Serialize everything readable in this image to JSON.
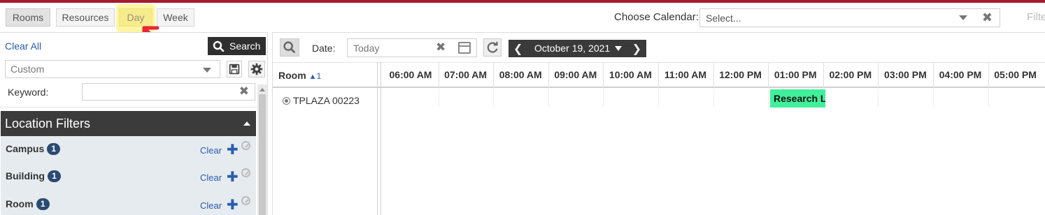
{
  "view_tabs": [
    {
      "label": "Rooms"
    },
    {
      "label": "Resources"
    },
    {
      "label": "Day"
    },
    {
      "label": "Week"
    }
  ],
  "calendar_chooser": {
    "label": "Choose Calendar:",
    "placeholder": "Select...",
    "trailing_text": "Filte"
  },
  "left_panel": {
    "clear_all": "Clear All",
    "search_label": "Search",
    "saved_search": "Custom",
    "keyword_label": "Keyword:",
    "keyword_value": "",
    "location_filters": {
      "title": "Location Filters",
      "rows": [
        {
          "name": "Campus",
          "count": "1",
          "clear": "Clear"
        },
        {
          "name": "Building",
          "count": "1",
          "clear": "Clear"
        },
        {
          "name": "Room",
          "count": "1",
          "clear": "Clear"
        }
      ]
    }
  },
  "right_panel": {
    "date_label": "Date:",
    "date_value": "Today",
    "current_date": "October 19, 2021",
    "room_column": {
      "label": "Room",
      "sort_order": "1"
    },
    "hours": [
      "06:00 AM",
      "07:00 AM",
      "08:00 AM",
      "09:00 AM",
      "10:00 AM",
      "11:00 AM",
      "12:00 PM",
      "01:00 PM",
      "02:00 PM",
      "03:00 PM",
      "04:00 PM",
      "05:00 PM"
    ],
    "rooms": [
      {
        "name": "TPLAZA 00223"
      }
    ],
    "events": [
      {
        "title": "Research L",
        "color": "#41f09a",
        "start": "01:00 PM"
      }
    ]
  },
  "colors": {
    "brand_bar": "#a6192e",
    "filter_header": "#3b3b3b",
    "badge": "#2b4a73",
    "link": "#2a5db0",
    "highlight": "#f6ec8c"
  }
}
